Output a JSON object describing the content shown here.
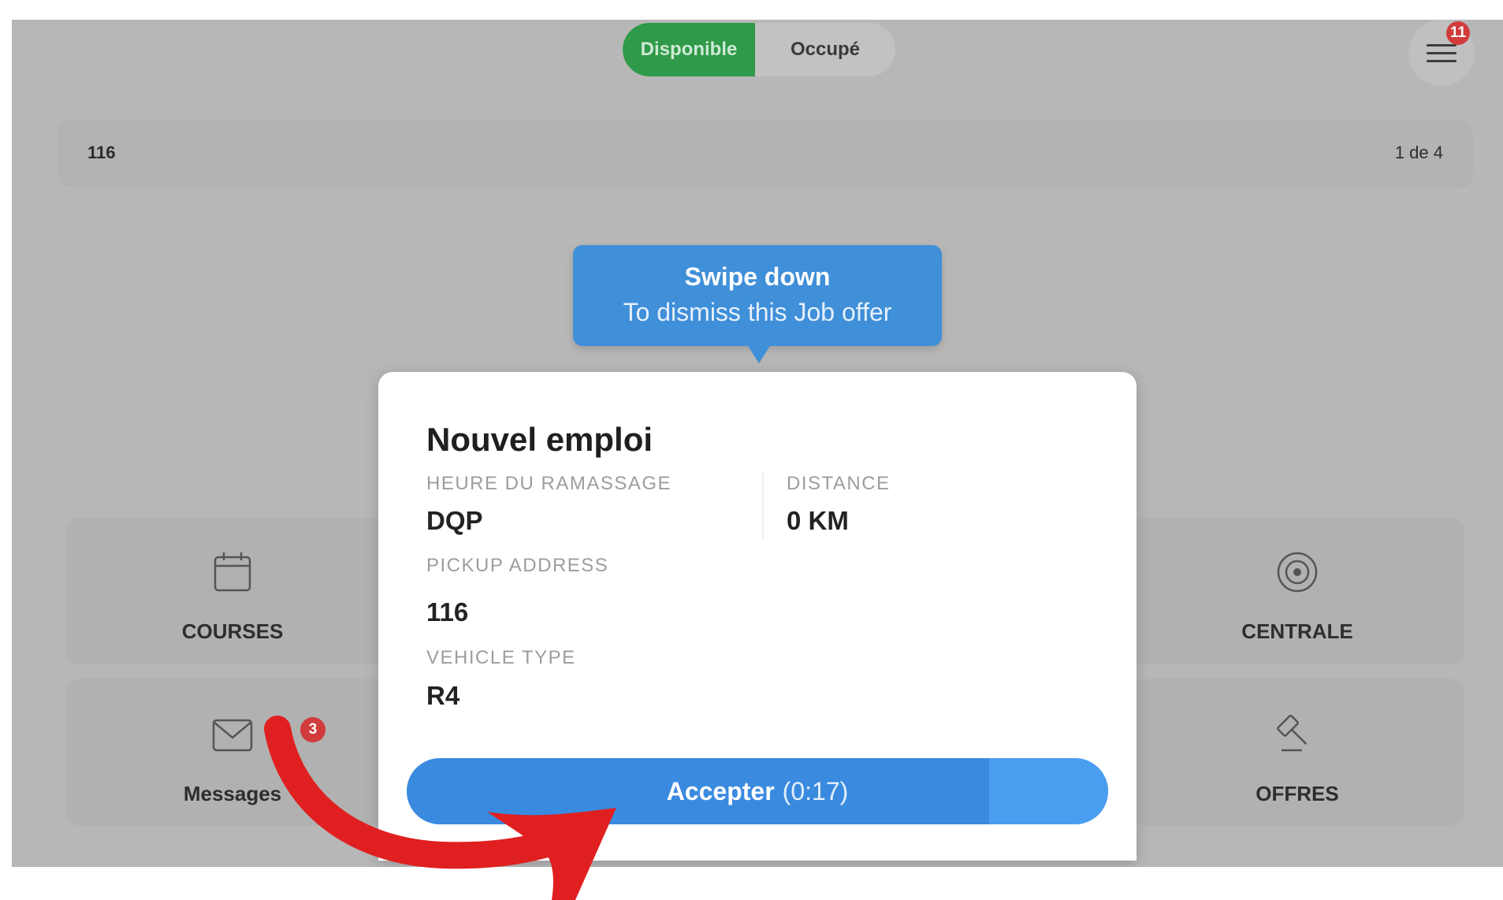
{
  "status_toggle": {
    "available_label": "Disponible",
    "busy_label": "Occupé",
    "active": "available"
  },
  "menu": {
    "icon": "hamburger-menu-icon",
    "badge_count": "11"
  },
  "info_bar": {
    "id": "116",
    "pagination": "1 de 4"
  },
  "tooltip": {
    "title": "Swipe down",
    "subtitle": "To dismiss this Job offer"
  },
  "tiles": {
    "courses": {
      "label": "COURSES",
      "icon": "calendar-icon"
    },
    "messages": {
      "label": "Messages",
      "icon": "envelope-icon",
      "badge_count": "3"
    },
    "centrale": {
      "label": "CENTRALE",
      "icon": "target-icon"
    },
    "offres": {
      "label": "OFFRES",
      "icon": "gavel-icon"
    }
  },
  "job_offer": {
    "title": "Nouvel emploi",
    "pickup_time_label": "HEURE DU RAMASSAGE",
    "pickup_time_value": "DQP",
    "distance_label": "DISTANCE",
    "distance_value": "0 KM",
    "pickup_address_label": "PICKUP ADDRESS",
    "pickup_address_value": "116",
    "vehicle_type_label": "VEHICLE TYPE",
    "vehicle_type_value": "R4",
    "accept_label": "Accepter",
    "accept_timer": "(0:17)",
    "accept_remaining_fraction": 0.17
  },
  "colors": {
    "available_green": "#2f9a49",
    "accent_blue": "#3a8ae0",
    "badge_red": "#d13b3b",
    "annotation_red": "#e02020"
  }
}
